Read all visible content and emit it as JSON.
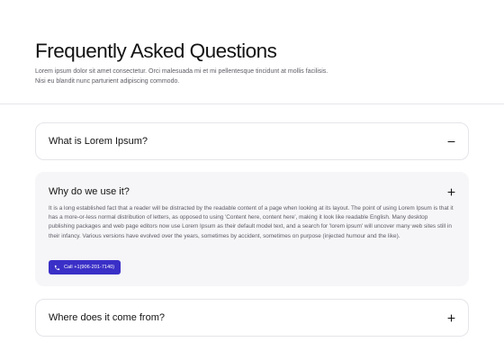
{
  "header": {
    "title": "Frequently Asked Questions",
    "subtitle": "Lorem ipsum dolor sit amet consectetur. Orci malesuada mi et mi pellentesque tincidunt at mollis facilisis. Nisi eu blandit nunc parturient adipiscing commodo."
  },
  "faq": {
    "items": [
      {
        "question": "What is Lorem Ipsum?",
        "expanded": false,
        "icon": "minus-icon"
      },
      {
        "question": "Why do we use it?",
        "expanded": true,
        "icon": "plus-icon",
        "answer": "It is a long established fact that a reader will be distracted by the readable content of a page when looking at its layout. The point of using Lorem Ipsum is that it has a more-or-less normal distribution of letters, as opposed to using 'Content here, content here', making it look like readable English. Many desktop publishing packages and web page editors now use Lorem Ipsum as their default model text, and a search for 'lorem ipsum' will uncover many web sites still in their infancy. Various versions have evolved over the years, sometimes by accident, sometimes on purpose (injected humour and the like).",
        "call_button": {
          "label": "Call +1(906-201-7140)",
          "icon": "phone-icon"
        }
      },
      {
        "question": "Where does it come from?",
        "expanded": false,
        "icon": "plus-icon"
      }
    ]
  },
  "colors": {
    "accent": "#3a2fc7",
    "expanded_background": "#f6f6f8",
    "border": "#e5e5ea",
    "muted_text": "#5d5d66"
  }
}
